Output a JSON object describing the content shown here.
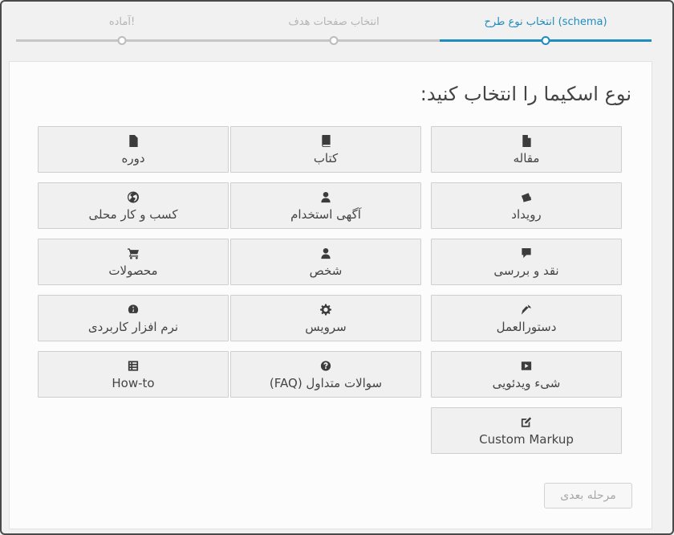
{
  "stepper": {
    "steps": [
      {
        "label": "انتخاب نوع طرح (schema)",
        "state": "active"
      },
      {
        "label": "انتخاب صفحات هدف",
        "state": "pending"
      },
      {
        "label": "آماده!",
        "state": "pending"
      }
    ],
    "active_color": "#1e8cbe"
  },
  "panel": {
    "heading": "نوع اسکیما را انتخاب کنید:"
  },
  "types": [
    {
      "label": "مقاله",
      "icon": "document-icon"
    },
    {
      "label": "کتاب",
      "icon": "book-icon"
    },
    {
      "label": "دوره",
      "icon": "document-icon"
    },
    {
      "label": "رویداد",
      "icon": "tickets-icon"
    },
    {
      "label": "آگهی استخدام",
      "icon": "person-icon"
    },
    {
      "label": "کسب و کار محلی",
      "icon": "globe-icon"
    },
    {
      "label": "نقد و بررسی",
      "icon": "comment-icon"
    },
    {
      "label": "شخص",
      "icon": "person-icon"
    },
    {
      "label": "محصولات",
      "icon": "cart-icon"
    },
    {
      "label": "دستورالعمل",
      "icon": "carrot-icon"
    },
    {
      "label": "سرویس",
      "icon": "gear-icon"
    },
    {
      "label": "نرم افزار کاربردی",
      "icon": "dashboard-icon"
    },
    {
      "label": "شیء ویدئویی",
      "icon": "video-icon"
    },
    {
      "label": "سوالات متداول (FAQ)",
      "icon": "help-icon"
    },
    {
      "label": "How-to",
      "icon": "list-icon"
    },
    {
      "label": "Custom Markup",
      "icon": "edit-icon"
    }
  ],
  "footer": {
    "next_label": "مرحله بعدی"
  }
}
